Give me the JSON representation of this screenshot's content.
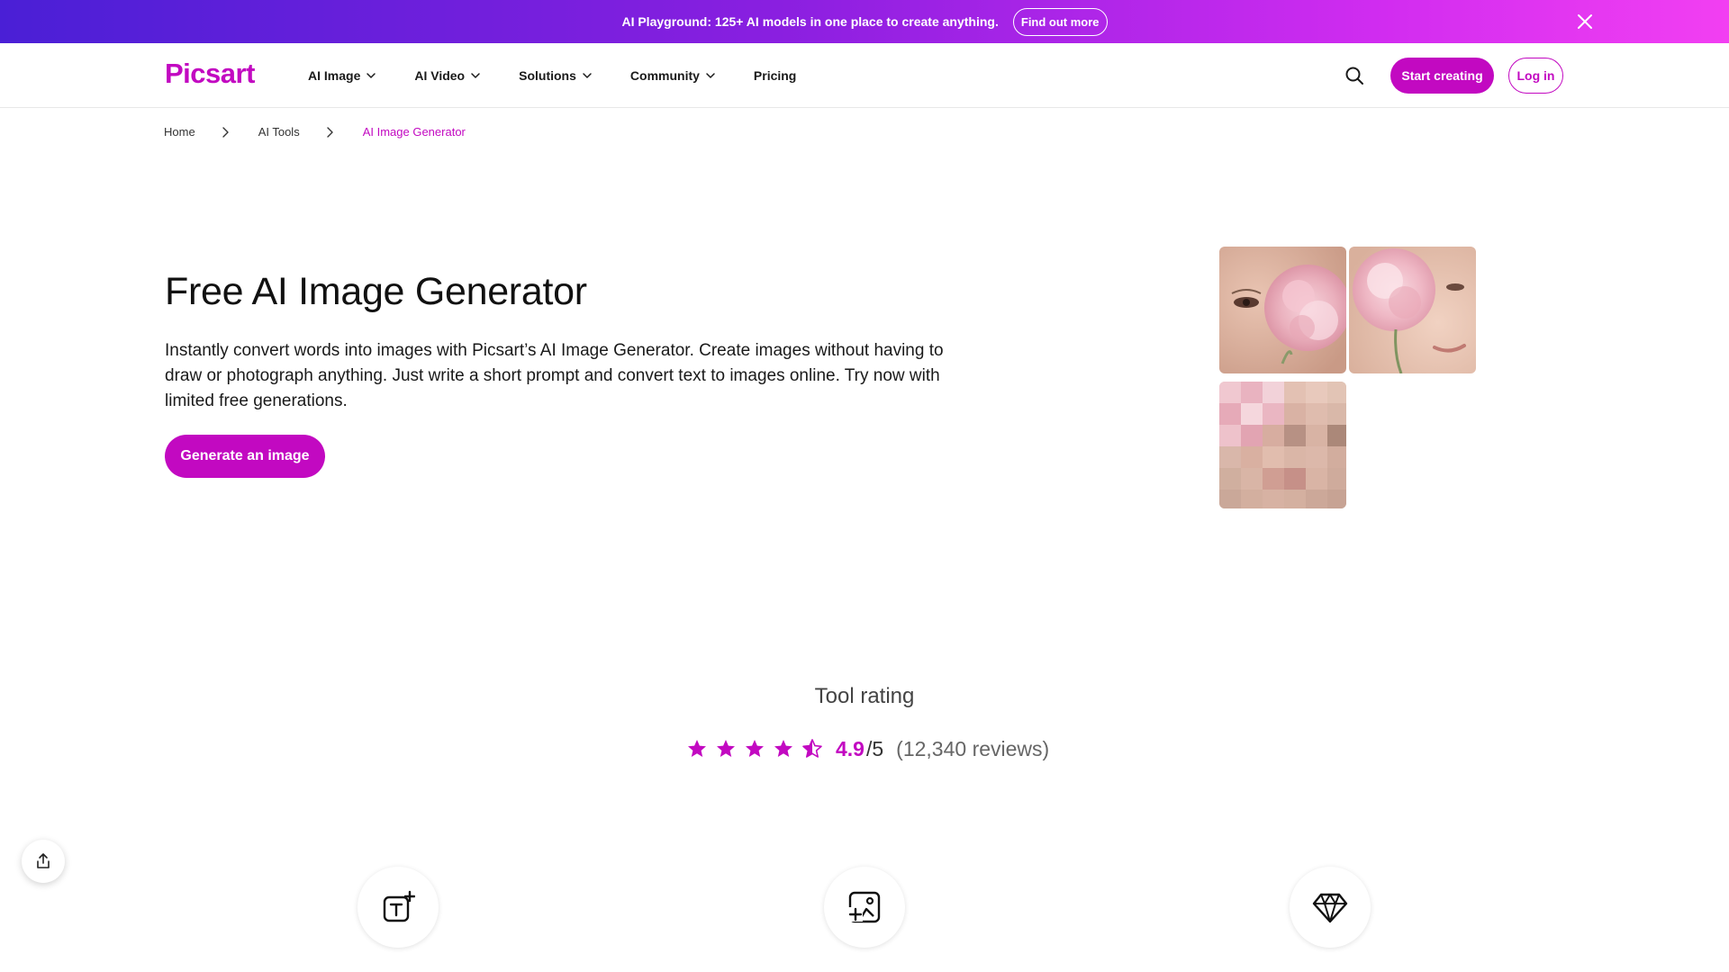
{
  "banner": {
    "text": "AI Playground: 125+ AI models in one place to create anything.",
    "cta_label": "Find out more",
    "close_icon": "close-icon",
    "gradient": [
      "#4a1fd6",
      "#8a1fe0",
      "#d12cf0",
      "#f23ff2"
    ]
  },
  "header": {
    "logo": "Picsart",
    "nav": [
      {
        "label": "AI Image",
        "dropdown": true
      },
      {
        "label": "AI Video",
        "dropdown": true
      },
      {
        "label": "Solutions",
        "dropdown": true
      },
      {
        "label": "Community",
        "dropdown": true
      },
      {
        "label": "Pricing",
        "dropdown": false
      }
    ],
    "search_icon": "search-icon",
    "start_label": "Start creating",
    "login_label": "Log in"
  },
  "breadcrumb": {
    "items": [
      "Home",
      "AI Tools",
      "AI Image Generator"
    ]
  },
  "hero": {
    "title": "Free AI Image Generator",
    "description": "Instantly convert words into images with Picsart’s AI Image Generator. Create images without having to draw or photograph anything. Just write a short prompt and convert text to images online. Try now with limited free generations.",
    "cta_label": "Generate an image",
    "images": [
      "woman-with-pink-flower-eye",
      "woman-with-pink-flower-face",
      "pixelated-woman-with-pink-flower"
    ]
  },
  "rating": {
    "title": "Tool rating",
    "stars": 4.5,
    "score": "4.9",
    "scale": "/5",
    "count": "(12,340 reviews)"
  },
  "share": {
    "icon": "share-icon"
  },
  "features": [
    {
      "icon": "text-plus-icon"
    },
    {
      "icon": "image-plus-icon"
    },
    {
      "icon": "diamond-icon"
    }
  ],
  "colors": {
    "brand": "#c209c1",
    "text": "#111111",
    "muted": "#666666"
  }
}
